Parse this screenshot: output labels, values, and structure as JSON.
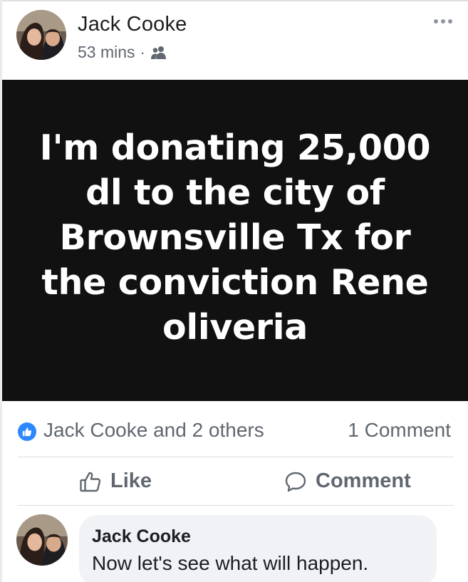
{
  "post": {
    "author": "Jack Cooke",
    "timestamp": "53 mins",
    "separator": "·",
    "audience_icon": "friends-icon",
    "more_icon": "more-options-icon",
    "status_text": "I'm donating 25,000 dl to the city of Brownsville Tx for the conviction Rene oliveria",
    "status_background": "#111111"
  },
  "reactions": {
    "icon": "like-badge-icon",
    "reactors": "Jack Cooke and 2 others",
    "comment_count": "1 Comment",
    "accent": "#2d88ff"
  },
  "actions": {
    "like_label": "Like",
    "like_icon": "thumbs-up-icon",
    "comment_label": "Comment",
    "comment_icon": "speech-bubble-icon"
  },
  "comments": [
    {
      "author": "Jack Cooke",
      "text": "Now let's see what will happen."
    }
  ]
}
